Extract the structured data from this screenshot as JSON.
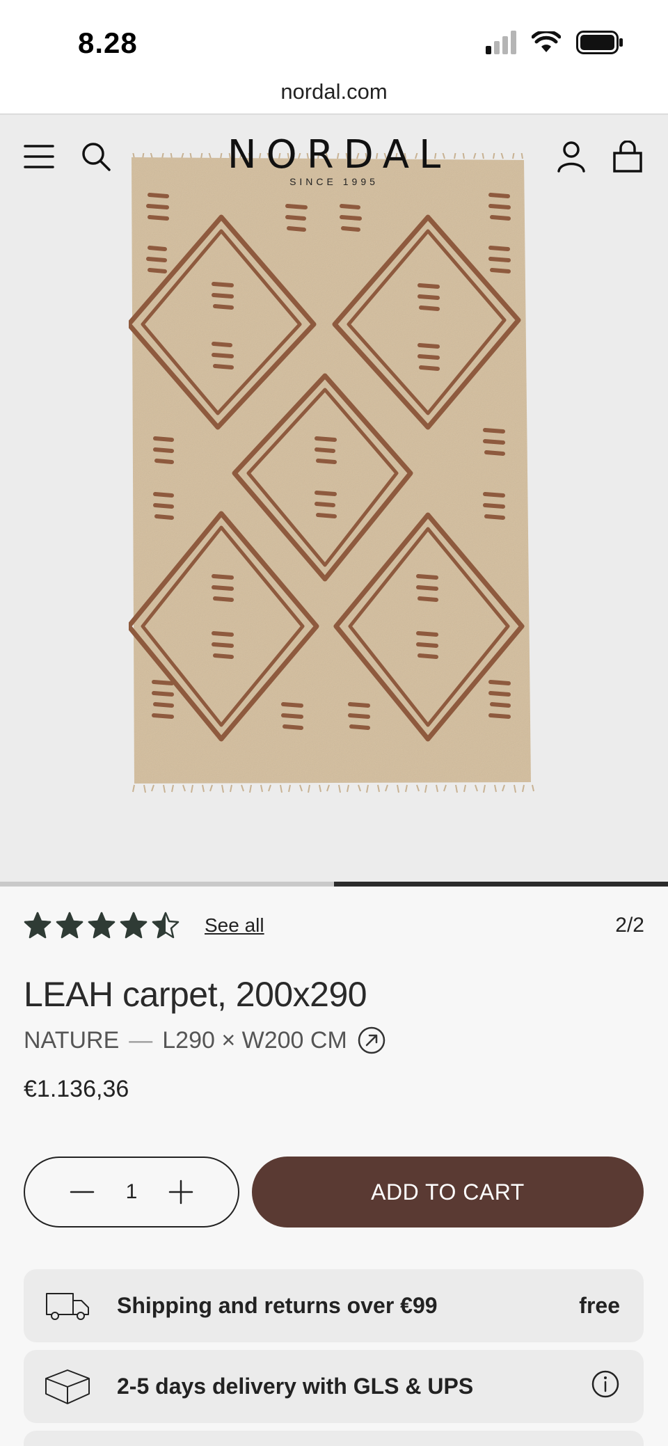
{
  "status": {
    "time": "8.28"
  },
  "browser": {
    "url": "nordal.com"
  },
  "header": {
    "logo": "NORDAL",
    "logo_sub": "SINCE 1995"
  },
  "gallery": {
    "current": 2,
    "total": 2,
    "counter": "2/2"
  },
  "rating": {
    "stars": 4.5,
    "max": 5,
    "see_all": "See all"
  },
  "product": {
    "title": "LEAH carpet, 200x290",
    "color": "NATURE",
    "separator": "—",
    "dimensions": "L290 × W200 CM",
    "price": "€1.136,36"
  },
  "cart": {
    "quantity": "1",
    "add_label": "ADD TO CART"
  },
  "info": [
    {
      "icon": "truck-icon",
      "text": "Shipping and returns over €99",
      "right": "free"
    },
    {
      "icon": "box-icon",
      "text": "2-5 days delivery with GLS & UPS",
      "right_icon": "info-icon"
    }
  ],
  "colors": {
    "accent": "#5a3a33",
    "star": "#2f3b35"
  }
}
